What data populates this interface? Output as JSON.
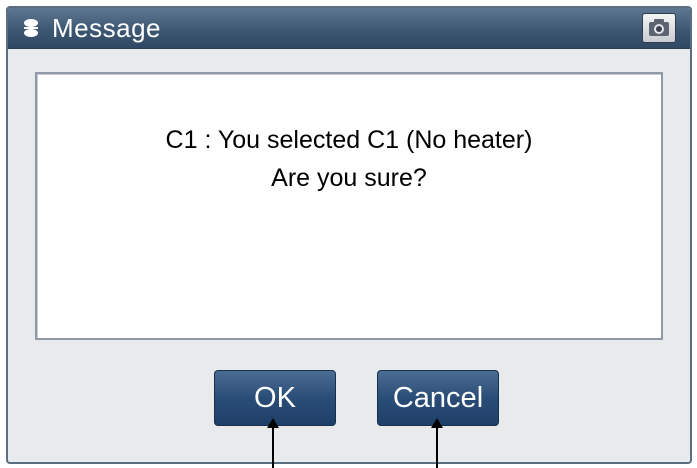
{
  "window": {
    "title": "Message",
    "icons": [
      "dialog-menu-icon",
      "screenshot-icon"
    ]
  },
  "message": {
    "line1": "C1 : You selected C1 (No heater)",
    "line2": "Are you sure?"
  },
  "buttons": {
    "ok_label": "OK",
    "cancel_label": "Cancel"
  },
  "colors": {
    "titlebar": "#3d5773",
    "button": "#2a4d77",
    "panel": "#ffffff",
    "dialog_bg": "#e9eaeb"
  }
}
